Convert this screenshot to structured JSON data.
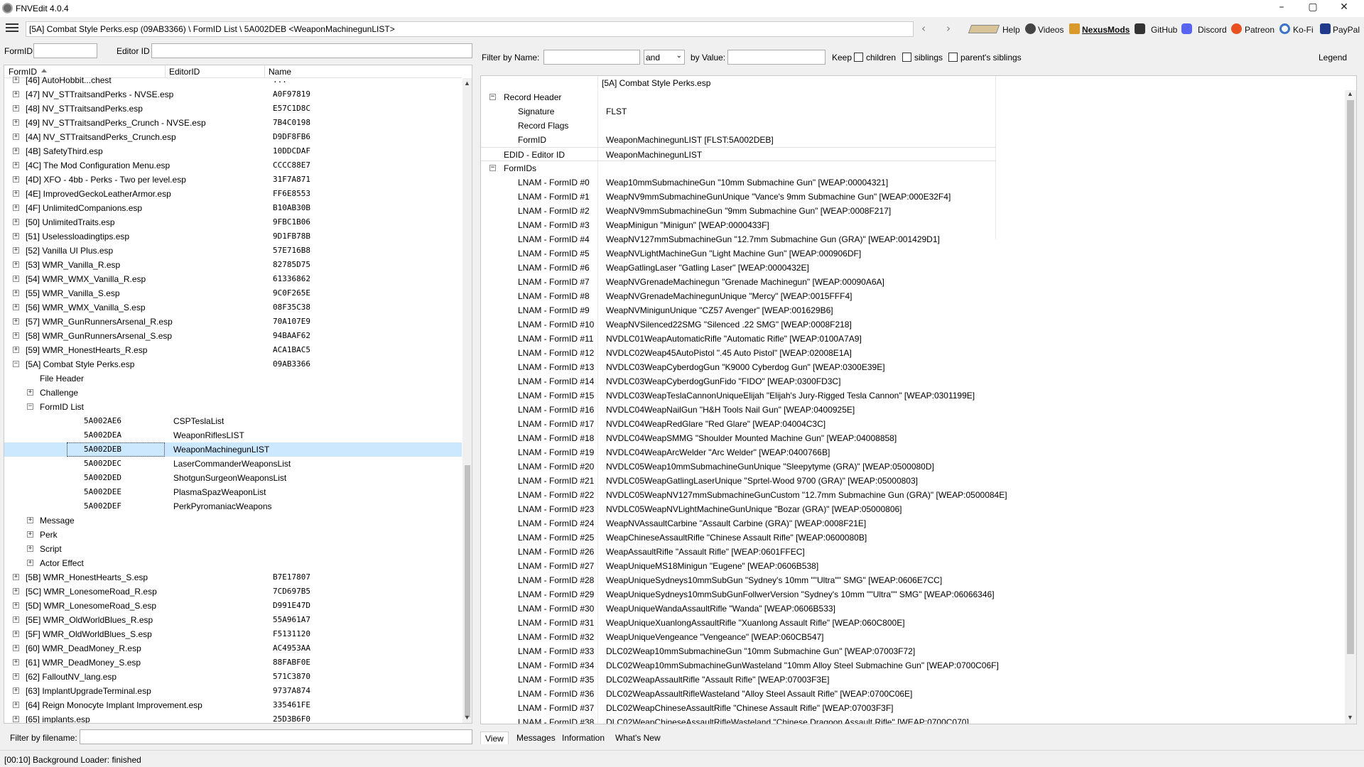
{
  "window": {
    "title": "FNVEdit 4.0.4",
    "minimize": "–",
    "maximize": "▢",
    "close": "✕"
  },
  "toolbar": {
    "path": "[5A] Combat Style Perks.esp (09AB3366) \\ FormID List \\ 5A002DEB <WeaponMachinegunLIST>",
    "back": "‹",
    "forward": "›",
    "links": {
      "help": "Help",
      "videos": "Videos",
      "nexusmods": "NexusMods",
      "github": "GitHub",
      "discord": "Discord",
      "patreon": "Patreon",
      "kofi": "Ko-Fi",
      "paypal": "PayPal"
    }
  },
  "left": {
    "formid_label": "FormID",
    "editorid_label": "Editor ID",
    "columns": {
      "formid": "FormID",
      "editorid": "EditorID",
      "name": "Name"
    },
    "filename_filter_label": "Filter by filename:",
    "rows": [
      {
        "level": 0,
        "exp": "+",
        "label": "[46] AutoHobbit...chest",
        "formid": "...",
        "editorid": ""
      },
      {
        "level": 0,
        "exp": "+",
        "label": "[47] NV_STTraitsandPerks - NVSE.esp",
        "formid": "A0F97819",
        "editorid": ""
      },
      {
        "level": 0,
        "exp": "+",
        "label": "[48] NV_STTraitsandPerks.esp",
        "formid": "E57C1D8C",
        "editorid": ""
      },
      {
        "level": 0,
        "exp": "+",
        "label": "[49] NV_STTraitsandPerks_Crunch - NVSE.esp",
        "formid": "7B4C0198",
        "editorid": ""
      },
      {
        "level": 0,
        "exp": "+",
        "label": "[4A] NV_STTraitsandPerks_Crunch.esp",
        "formid": "D9DF8FB6",
        "editorid": ""
      },
      {
        "level": 0,
        "exp": "+",
        "label": "[4B] SafetyThird.esp",
        "formid": "10DDCDAF",
        "editorid": ""
      },
      {
        "level": 0,
        "exp": "+",
        "label": "[4C] The Mod Configuration Menu.esp",
        "formid": "CCCC88E7",
        "editorid": ""
      },
      {
        "level": 0,
        "exp": "+",
        "label": "[4D] XFO - 4bb - Perks - Two per level.esp",
        "formid": "31F7A871",
        "editorid": ""
      },
      {
        "level": 0,
        "exp": "+",
        "label": "[4E] ImprovedGeckoLeatherArmor.esp",
        "formid": "FF6E8553",
        "editorid": ""
      },
      {
        "level": 0,
        "exp": "+",
        "label": "[4F] UnlimitedCompanions.esp",
        "formid": "B10AB30B",
        "editorid": ""
      },
      {
        "level": 0,
        "exp": "+",
        "label": "[50] UnlimitedTraits.esp",
        "formid": "9FBC1B06",
        "editorid": ""
      },
      {
        "level": 0,
        "exp": "+",
        "label": "[51] Uselessloadingtips.esp",
        "formid": "9D1FB78B",
        "editorid": ""
      },
      {
        "level": 0,
        "exp": "+",
        "label": "[52] Vanilla UI Plus.esp",
        "formid": "57E716B8",
        "editorid": ""
      },
      {
        "level": 0,
        "exp": "+",
        "label": "[53] WMR_Vanilla_R.esp",
        "formid": "82785D75",
        "editorid": ""
      },
      {
        "level": 0,
        "exp": "+",
        "label": "[54] WMR_WMX_Vanilla_R.esp",
        "formid": "61336862",
        "editorid": ""
      },
      {
        "level": 0,
        "exp": "+",
        "label": "[55] WMR_Vanilla_S.esp",
        "formid": "9C0F265E",
        "editorid": ""
      },
      {
        "level": 0,
        "exp": "+",
        "label": "[56] WMR_WMX_Vanilla_S.esp",
        "formid": "08F35C38",
        "editorid": ""
      },
      {
        "level": 0,
        "exp": "+",
        "label": "[57] WMR_GunRunnersArsenal_R.esp",
        "formid": "70A107E9",
        "editorid": ""
      },
      {
        "level": 0,
        "exp": "+",
        "label": "[58] WMR_GunRunnersArsenal_S.esp",
        "formid": "94BAAF62",
        "editorid": ""
      },
      {
        "level": 0,
        "exp": "+",
        "label": "[59] WMR_HonestHearts_R.esp",
        "formid": "ACA1BAC5",
        "editorid": ""
      },
      {
        "level": 0,
        "exp": "−",
        "label": "[5A] Combat Style Perks.esp",
        "formid": "09AB3366",
        "editorid": ""
      },
      {
        "level": 1,
        "exp": "",
        "label": "File Header",
        "formid": "",
        "editorid": ""
      },
      {
        "level": 1,
        "exp": "+",
        "label": "Challenge",
        "formid": "",
        "editorid": ""
      },
      {
        "level": 1,
        "exp": "−",
        "label": "FormID List",
        "formid": "",
        "editorid": ""
      },
      {
        "level": 2,
        "exp": "",
        "label": "5A002AE6",
        "formid": "",
        "editorid": "CSPTeslaList"
      },
      {
        "level": 2,
        "exp": "",
        "label": "5A002DEA",
        "formid": "",
        "editorid": "WeaponRiflesLIST"
      },
      {
        "level": 2,
        "exp": "",
        "label": "5A002DEB",
        "formid": "",
        "editorid": "WeaponMachinegunLIST",
        "selected": true
      },
      {
        "level": 2,
        "exp": "",
        "label": "5A002DEC",
        "formid": "",
        "editorid": "LaserCommanderWeaponsList"
      },
      {
        "level": 2,
        "exp": "",
        "label": "5A002DED",
        "formid": "",
        "editorid": "ShotgunSurgeonWeaponsList"
      },
      {
        "level": 2,
        "exp": "",
        "label": "5A002DEE",
        "formid": "",
        "editorid": "PlasmaSpazWeaponList"
      },
      {
        "level": 2,
        "exp": "",
        "label": "5A002DEF",
        "formid": "",
        "editorid": "PerkPyromaniacWeapons"
      },
      {
        "level": 1,
        "exp": "+",
        "label": "Message",
        "formid": "",
        "editorid": ""
      },
      {
        "level": 1,
        "exp": "+",
        "label": "Perk",
        "formid": "",
        "editorid": ""
      },
      {
        "level": 1,
        "exp": "+",
        "label": "Script",
        "formid": "",
        "editorid": ""
      },
      {
        "level": 1,
        "exp": "+",
        "label": "Actor Effect",
        "formid": "",
        "editorid": ""
      },
      {
        "level": 0,
        "exp": "+",
        "label": "[5B] WMR_HonestHearts_S.esp",
        "formid": "B7E17807",
        "editorid": ""
      },
      {
        "level": 0,
        "exp": "+",
        "label": "[5C] WMR_LonesomeRoad_R.esp",
        "formid": "7CD697B5",
        "editorid": ""
      },
      {
        "level": 0,
        "exp": "+",
        "label": "[5D] WMR_LonesomeRoad_S.esp",
        "formid": "D991E47D",
        "editorid": ""
      },
      {
        "level": 0,
        "exp": "+",
        "label": "[5E] WMR_OldWorldBlues_R.esp",
        "formid": "55A961A7",
        "editorid": ""
      },
      {
        "level": 0,
        "exp": "+",
        "label": "[5F] WMR_OldWorldBlues_S.esp",
        "formid": "F5131120",
        "editorid": ""
      },
      {
        "level": 0,
        "exp": "+",
        "label": "[60] WMR_DeadMoney_R.esp",
        "formid": "AC4953AA",
        "editorid": ""
      },
      {
        "level": 0,
        "exp": "+",
        "label": "[61] WMR_DeadMoney_S.esp",
        "formid": "88FABF0E",
        "editorid": ""
      },
      {
        "level": 0,
        "exp": "+",
        "label": "[62] FalloutNV_lang.esp",
        "formid": "571C3870",
        "editorid": ""
      },
      {
        "level": 0,
        "exp": "+",
        "label": "[63] ImplantUpgradeTerminal.esp",
        "formid": "9737A874",
        "editorid": ""
      },
      {
        "level": 0,
        "exp": "+",
        "label": "[64] Reign Monocyte Implant Improvement.esp",
        "formid": "335461FE",
        "editorid": ""
      },
      {
        "level": 0,
        "exp": "+",
        "label": "[65] implants.esp",
        "formid": "25D3B6F0",
        "editorid": ""
      }
    ]
  },
  "right": {
    "filter_name_label": "Filter by Name:",
    "and_value": "and",
    "filter_value_label": "by Value:",
    "keep_label": "Keep",
    "children_label": "children",
    "siblings_label": "siblings",
    "parents_siblings_label": "parent's siblings",
    "legend_label": "Legend",
    "file_header": "[5A] Combat Style Perks.esp",
    "rows": [
      {
        "level": 0,
        "exp": "−",
        "key": "Record Header",
        "value": ""
      },
      {
        "level": 1,
        "exp": "",
        "key": "Signature",
        "value": "FLST"
      },
      {
        "level": 1,
        "exp": "",
        "key": "Record Flags",
        "value": ""
      },
      {
        "level": 1,
        "exp": "",
        "key": "FormID",
        "value": "WeaponMachinegunLIST [FLST:5A002DEB]"
      },
      {
        "level": 0,
        "exp": "",
        "key": "EDID - Editor ID",
        "value": "WeaponMachinegunLIST"
      },
      {
        "level": 0,
        "exp": "−",
        "key": "FormIDs",
        "value": ""
      },
      {
        "level": 1,
        "exp": "",
        "key": "LNAM - FormID #0",
        "value": "Weap10mmSubmachineGun \"10mm Submachine Gun\" [WEAP:00004321]"
      },
      {
        "level": 1,
        "exp": "",
        "key": "LNAM - FormID #1",
        "value": "WeapNV9mmSubmachineGunUnique \"Vance's 9mm Submachine Gun\" [WEAP:000E32F4]"
      },
      {
        "level": 1,
        "exp": "",
        "key": "LNAM - FormID #2",
        "value": "WeapNV9mmSubmachineGun \"9mm Submachine Gun\" [WEAP:0008F217]"
      },
      {
        "level": 1,
        "exp": "",
        "key": "LNAM - FormID #3",
        "value": "WeapMinigun \"Minigun\" [WEAP:0000433F]"
      },
      {
        "level": 1,
        "exp": "",
        "key": "LNAM - FormID #4",
        "value": "WeapNV127mmSubmachineGun \"12.7mm Submachine Gun (GRA)\" [WEAP:001429D1]"
      },
      {
        "level": 1,
        "exp": "",
        "key": "LNAM - FormID #5",
        "value": "WeapNVLightMachineGun \"Light Machine Gun\" [WEAP:000906DF]"
      },
      {
        "level": 1,
        "exp": "",
        "key": "LNAM - FormID #6",
        "value": "WeapGatlingLaser \"Gatling Laser\" [WEAP:0000432E]"
      },
      {
        "level": 1,
        "exp": "",
        "key": "LNAM - FormID #7",
        "value": "WeapNVGrenadeMachinegun \"Grenade Machinegun\" [WEAP:00090A6A]"
      },
      {
        "level": 1,
        "exp": "",
        "key": "LNAM - FormID #8",
        "value": "WeapNVGrenadeMachinegunUnique \"Mercy\" [WEAP:0015FFF4]"
      },
      {
        "level": 1,
        "exp": "",
        "key": "LNAM - FormID #9",
        "value": "WeapNVMinigunUnique \"CZ57 Avenger\" [WEAP:001629B6]"
      },
      {
        "level": 1,
        "exp": "",
        "key": "LNAM - FormID #10",
        "value": "WeapNVSilenced22SMG \"Silenced .22 SMG\" [WEAP:0008F218]"
      },
      {
        "level": 1,
        "exp": "",
        "key": "LNAM - FormID #11",
        "value": "NVDLC01WeapAutomaticRifle \"Automatic Rifle\" [WEAP:0100A7A9]"
      },
      {
        "level": 1,
        "exp": "",
        "key": "LNAM - FormID #12",
        "value": "NVDLC02Weap45AutoPistol \".45 Auto Pistol\" [WEAP:02008E1A]"
      },
      {
        "level": 1,
        "exp": "",
        "key": "LNAM - FormID #13",
        "value": "NVDLC03WeapCyberdogGun \"K9000 Cyberdog Gun\" [WEAP:0300E39E]"
      },
      {
        "level": 1,
        "exp": "",
        "key": "LNAM - FormID #14",
        "value": "NVDLC03WeapCyberdogGunFido \"FIDO\" [WEAP:0300FD3C]"
      },
      {
        "level": 1,
        "exp": "",
        "key": "LNAM - FormID #15",
        "value": "NVDLC03WeapTeslaCannonUniqueElijah \"Elijah's Jury-Rigged Tesla Cannon\" [WEAP:0301199E]"
      },
      {
        "level": 1,
        "exp": "",
        "key": "LNAM - FormID #16",
        "value": "NVDLC04WeapNailGun \"H&H Tools Nail Gun\" [WEAP:0400925E]"
      },
      {
        "level": 1,
        "exp": "",
        "key": "LNAM - FormID #17",
        "value": "NVDLC04WeapRedGlare \"Red Glare\" [WEAP:04004C3C]"
      },
      {
        "level": 1,
        "exp": "",
        "key": "LNAM - FormID #18",
        "value": "NVDLC04WeapSMMG \"Shoulder Mounted Machine Gun\" [WEAP:04008858]"
      },
      {
        "level": 1,
        "exp": "",
        "key": "LNAM - FormID #19",
        "value": "NVDLC04WeapArcWelder \"Arc Welder\" [WEAP:0400766B]"
      },
      {
        "level": 1,
        "exp": "",
        "key": "LNAM - FormID #20",
        "value": "NVDLC05Weap10mmSubmachineGunUnique \"Sleepytyme (GRA)\" [WEAP:0500080D]"
      },
      {
        "level": 1,
        "exp": "",
        "key": "LNAM - FormID #21",
        "value": "NVDLC05WeapGatlingLaserUnique \"Sprtel-Wood 9700 (GRA)\" [WEAP:05000803]"
      },
      {
        "level": 1,
        "exp": "",
        "key": "LNAM - FormID #22",
        "value": "NVDLC05WeapNV127mmSubmachineGunCustom \"12.7mm Submachine Gun (GRA)\" [WEAP:0500084E]"
      },
      {
        "level": 1,
        "exp": "",
        "key": "LNAM - FormID #23",
        "value": "NVDLC05WeapNVLightMachineGunUnique \"Bozar (GRA)\" [WEAP:05000806]"
      },
      {
        "level": 1,
        "exp": "",
        "key": "LNAM - FormID #24",
        "value": "WeapNVAssaultCarbine \"Assault Carbine (GRA)\" [WEAP:0008F21E]"
      },
      {
        "level": 1,
        "exp": "",
        "key": "LNAM - FormID #25",
        "value": "WeapChineseAssaultRifle \"Chinese Assault Rifle\" [WEAP:0600080B]"
      },
      {
        "level": 1,
        "exp": "",
        "key": "LNAM - FormID #26",
        "value": "WeapAssaultRifle \"Assault Rifle\" [WEAP:0601FFEC]"
      },
      {
        "level": 1,
        "exp": "",
        "key": "LNAM - FormID #27",
        "value": "WeapUniqueMS18Minigun \"Eugene\" [WEAP:0606B538]"
      },
      {
        "level": 1,
        "exp": "",
        "key": "LNAM - FormID #28",
        "value": "WeapUniqueSydneys10mmSubGun \"Sydney's 10mm \"\"Ultra\"\" SMG\" [WEAP:0606E7CC]"
      },
      {
        "level": 1,
        "exp": "",
        "key": "LNAM - FormID #29",
        "value": "WeapUniqueSydneys10mmSubGunFollwerVersion \"Sydney's 10mm \"\"Ultra\"\" SMG\" [WEAP:06066346]"
      },
      {
        "level": 1,
        "exp": "",
        "key": "LNAM - FormID #30",
        "value": "WeapUniqueWandaAssaultRifle \"Wanda\" [WEAP:0606B533]"
      },
      {
        "level": 1,
        "exp": "",
        "key": "LNAM - FormID #31",
        "value": "WeapUniqueXuanlongAssaultRifle \"Xuanlong Assault Rifle\" [WEAP:060C800E]"
      },
      {
        "level": 1,
        "exp": "",
        "key": "LNAM - FormID #32",
        "value": "WeapUniqueVengeance \"Vengeance\" [WEAP:060CB547]"
      },
      {
        "level": 1,
        "exp": "",
        "key": "LNAM - FormID #33",
        "value": "DLC02Weap10mmSubmachineGun \"10mm Submachine Gun\" [WEAP:07003F72]"
      },
      {
        "level": 1,
        "exp": "",
        "key": "LNAM - FormID #34",
        "value": "DLC02Weap10mmSubmachineGunWasteland \"10mm Alloy Steel Submachine Gun\" [WEAP:0700C06F]"
      },
      {
        "level": 1,
        "exp": "",
        "key": "LNAM - FormID #35",
        "value": "DLC02WeapAssaultRifle \"Assault Rifle\" [WEAP:07003F3E]"
      },
      {
        "level": 1,
        "exp": "",
        "key": "LNAM - FormID #36",
        "value": "DLC02WeapAssaultRifleWasteland \"Alloy Steel Assault Rifle\" [WEAP:0700C06E]"
      },
      {
        "level": 1,
        "exp": "",
        "key": "LNAM - FormID #37",
        "value": "DLC02WeapChineseAssaultRifle \"Chinese Assault Rifle\" [WEAP:07003F3F]"
      },
      {
        "level": 1,
        "exp": "",
        "key": "LNAM - FormID #38",
        "value": "DLC02WeapChineseAssaultRifleWasteland \"Chinese Dragoon Assault Rifle\" [WEAP:0700C070]"
      }
    ]
  },
  "tabs": [
    "View",
    "Messages",
    "Information",
    "What's New"
  ],
  "status": "[00:10] Background Loader: finished"
}
